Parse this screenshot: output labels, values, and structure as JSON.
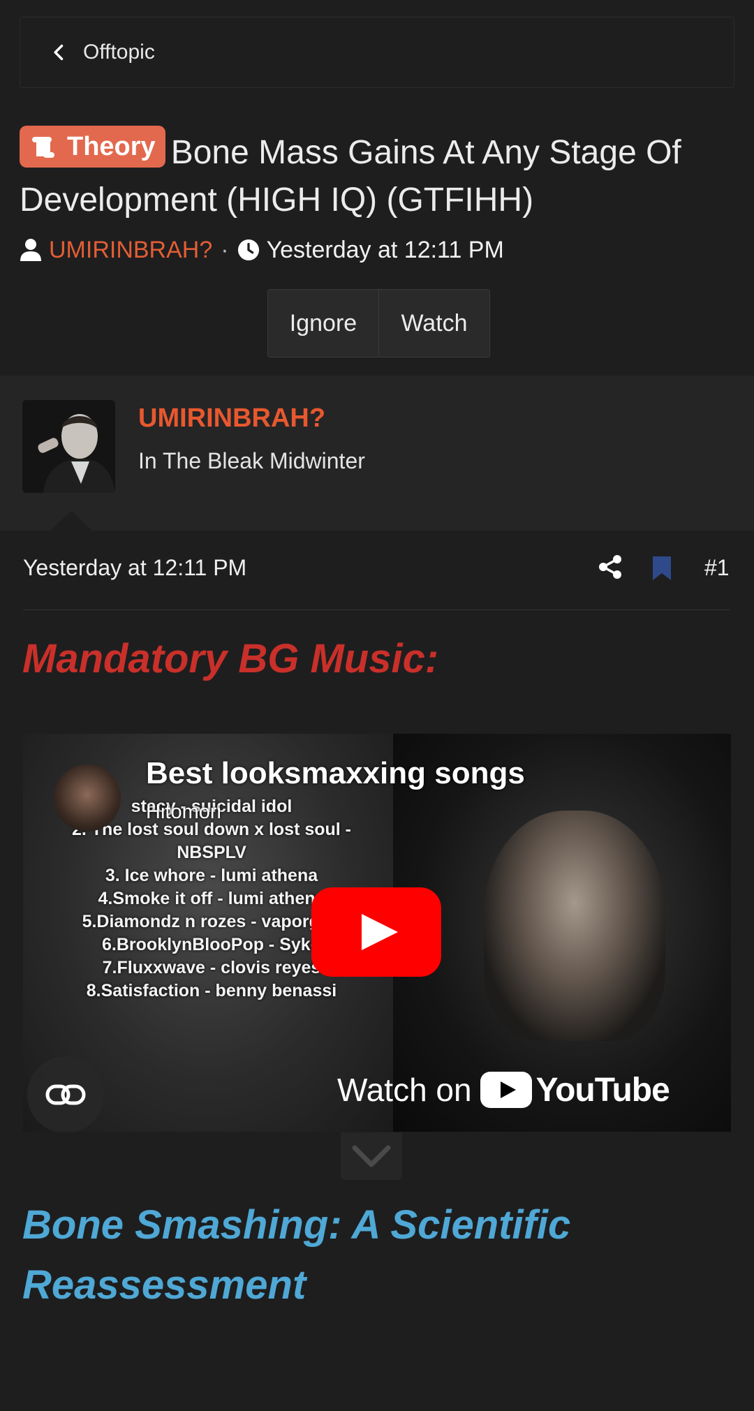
{
  "breadcrumb": {
    "label": "Offtopic"
  },
  "thread": {
    "prefix": "Theory",
    "title": "Bone Mass Gains At Any Stage Of Development (HIGH IQ) (GTFIHH)",
    "author": "UMIRINBRAH?",
    "separator": "·",
    "date": "Yesterday at 12:11 PM"
  },
  "actions": {
    "ignore": "Ignore",
    "watch": "Watch"
  },
  "user": {
    "name": "UMIRINBRAH?",
    "title": "In The Bleak Midwinter"
  },
  "post": {
    "date": "Yesterday at 12:11 PM",
    "number": "#1",
    "heading1": "Mandatory BG Music:",
    "heading2": "Bone Smashing: A Scientific Reassessment"
  },
  "video": {
    "title": "Best looksmaxxing songs",
    "channel": "Hitomori",
    "watch_on": "Watch on",
    "youtube": "YouTube",
    "songs": [
      "stacy - suicidal idol",
      "2. The lost soul down x lost soul - NBSPLV",
      "3. Ice whore - lumi athena",
      "4.Smoke it off - lumi athena",
      "5.Diamondz n rozes - vaporgod",
      "6.BrooklynBlooPop - Syko",
      "7.Fluxxwave - clovis reyes",
      "8.Satisfaction - benny benassi"
    ]
  },
  "colors": {
    "accent_orange": "#e35e34",
    "prefix_bg": "#e2694e",
    "heading_red": "#c9302a",
    "heading_blue": "#4fa8d5",
    "bookmark_blue": "#2f4a8a",
    "youtube_red": "#ff0000"
  }
}
